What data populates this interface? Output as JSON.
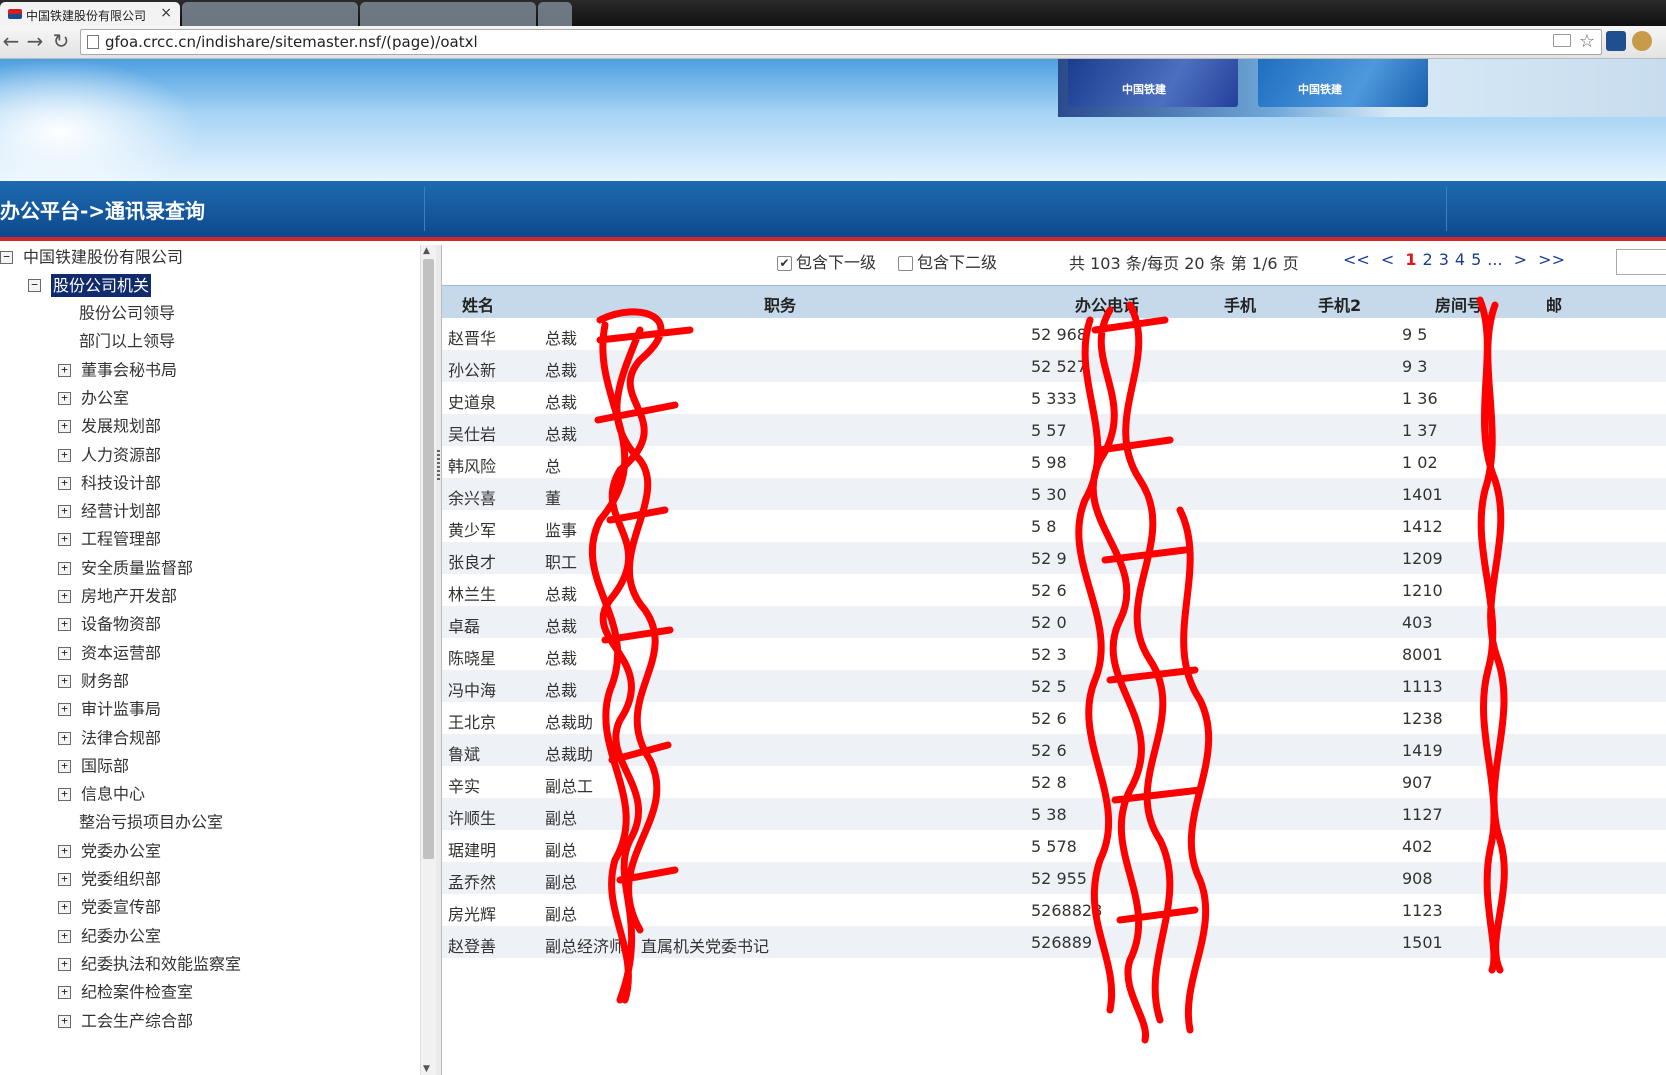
{
  "browser": {
    "tabs": [
      {
        "title": "中国铁建股份有限公司",
        "close": "×"
      }
    ],
    "url": "gfoa.crcc.cn/indishare/sitemaster.nsf/(page)/oatxl"
  },
  "banner": {
    "flags": [
      "中国铁建",
      "中国铁建"
    ]
  },
  "nav": {
    "breadcrumb": "办公平台->通讯录查询"
  },
  "tree": {
    "root": "中国铁建股份有限公司",
    "group": "股份公司机关",
    "items": [
      {
        "label": "股份公司领导",
        "expandable": false
      },
      {
        "label": "部门以上领导",
        "expandable": false
      },
      {
        "label": "董事会秘书局",
        "expandable": true
      },
      {
        "label": "办公室",
        "expandable": true
      },
      {
        "label": "发展规划部",
        "expandable": true
      },
      {
        "label": "人力资源部",
        "expandable": true
      },
      {
        "label": "科技设计部",
        "expandable": true
      },
      {
        "label": "经营计划部",
        "expandable": true
      },
      {
        "label": "工程管理部",
        "expandable": true
      },
      {
        "label": "安全质量监督部",
        "expandable": true
      },
      {
        "label": "房地产开发部",
        "expandable": true
      },
      {
        "label": "设备物资部",
        "expandable": true
      },
      {
        "label": "资本运营部",
        "expandable": true
      },
      {
        "label": "财务部",
        "expandable": true
      },
      {
        "label": "审计监事局",
        "expandable": true
      },
      {
        "label": "法律合规部",
        "expandable": true
      },
      {
        "label": "国际部",
        "expandable": true
      },
      {
        "label": "信息中心",
        "expandable": true
      },
      {
        "label": "整治亏损项目办公室",
        "expandable": false
      },
      {
        "label": "党委办公室",
        "expandable": true
      },
      {
        "label": "党委组织部",
        "expandable": true
      },
      {
        "label": "党委宣传部",
        "expandable": true
      },
      {
        "label": "纪委办公室",
        "expandable": true
      },
      {
        "label": "纪委执法和效能监察室",
        "expandable": true
      },
      {
        "label": "纪检案件检查室",
        "expandable": true
      },
      {
        "label": "工会生产综合部",
        "expandable": true
      }
    ]
  },
  "filters": {
    "include_level1": {
      "label": "包含下一级",
      "checked": true
    },
    "include_level2": {
      "label": "包含下二级",
      "checked": false
    }
  },
  "pager": {
    "summary": "共 103 条/每页 20 条 第 1/6 页",
    "first": "<<",
    "prev": "<",
    "pages": [
      "1",
      "2",
      "3",
      "4",
      "5"
    ],
    "ellipsis": "...",
    "next": ">",
    "last": ">>",
    "current": "1"
  },
  "table": {
    "headers": {
      "name": "姓名",
      "title": "职务",
      "office_phone": "办公电话",
      "mobile": "手机",
      "mobile2": "手机2",
      "room": "房间号",
      "email": "邮"
    },
    "rows": [
      {
        "name": "赵晋华",
        "title": "总裁",
        "phone": "52  968",
        "room": "9 5"
      },
      {
        "name": "孙公新",
        "title": "总裁",
        "phone": "52  527",
        "room": "9 3"
      },
      {
        "name": "史道泉",
        "title": "总裁",
        "phone": "5   333",
        "room": "1 36"
      },
      {
        "name": "吴仕岩",
        "title": "总裁",
        "phone": "5   57",
        "room": "1 37"
      },
      {
        "name": "韩风险",
        "title": "总",
        "phone": "5   98",
        "room": "1 02"
      },
      {
        "name": "余兴喜",
        "title": "董",
        "phone": "5   30",
        "room": "1401"
      },
      {
        "name": "黄少军",
        "title": "监事",
        "phone": "5   8",
        "room": "1412"
      },
      {
        "name": "张良才",
        "title": "职工",
        "phone": "52  9",
        "room": "1209"
      },
      {
        "name": "林兰生",
        "title": "总裁",
        "phone": "52  6",
        "room": "1210"
      },
      {
        "name": "卓磊",
        "title": "总裁",
        "phone": "52  0",
        "room": "403"
      },
      {
        "name": "陈晓星",
        "title": "总裁",
        "phone": "52  3",
        "room": "8001"
      },
      {
        "name": "冯中海",
        "title": "总裁",
        "phone": "52  5",
        "room": "1113"
      },
      {
        "name": "王北京",
        "title": "总裁助",
        "phone": "52  6",
        "room": "1238"
      },
      {
        "name": "鲁斌",
        "title": "总裁助",
        "phone": "52  6",
        "room": "1419"
      },
      {
        "name": "辛实",
        "title": "副总工",
        "phone": "52  8",
        "room": "907"
      },
      {
        "name": "许顺生",
        "title": "副总",
        "phone": "5   38",
        "room": "1127"
      },
      {
        "name": "琚建明",
        "title": "副总",
        "phone": "5   578",
        "room": "402"
      },
      {
        "name": "孟乔然",
        "title": "副总",
        "phone": "52  955",
        "room": "908"
      },
      {
        "name": "房光辉",
        "title": "副总",
        "phone": "5268828",
        "room": "1123"
      },
      {
        "name": "赵登善",
        "title": "副总经济师、直属机关党委书记",
        "phone": "526889",
        "room": "1501"
      }
    ]
  },
  "colors": {
    "nav_blue": "#0c4a8c",
    "nav_red_line": "#d4262d",
    "header_row": "#c6d9ea",
    "selected_node": "#102a6b",
    "current_page": "#e0141b",
    "redaction": "#ff0000"
  }
}
